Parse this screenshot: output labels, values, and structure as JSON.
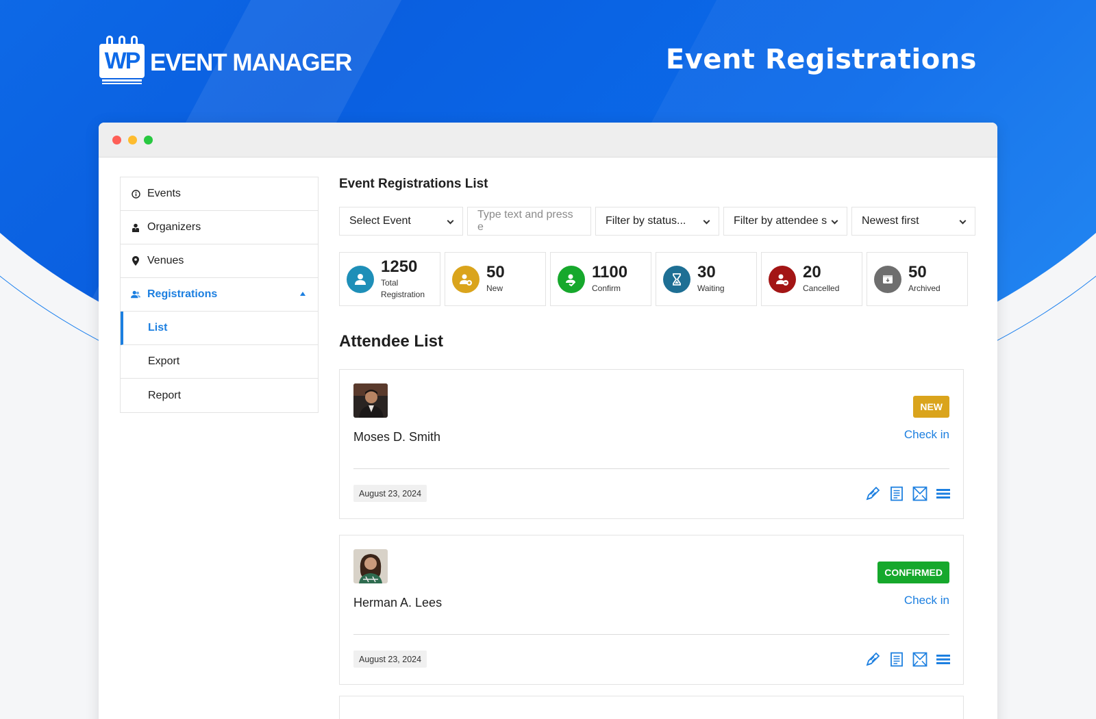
{
  "brand": {
    "logo_letters": "WP",
    "name": "EVENT MANAGER"
  },
  "page_heading": "Event Registrations",
  "colors": {
    "accent": "#1c7fe0",
    "hero": "#0a5fe0",
    "new": "#daa41c",
    "confirmed": "#16a82c"
  },
  "sidebar": {
    "items": [
      {
        "label": "Events",
        "icon": "info-icon"
      },
      {
        "label": "Organizers",
        "icon": "person-icon"
      },
      {
        "label": "Venues",
        "icon": "map-pin-icon"
      },
      {
        "label": "Registrations",
        "icon": "users-icon",
        "expanded": true
      },
      {
        "label": "List",
        "selected": true
      },
      {
        "label": "Export"
      },
      {
        "label": "Report"
      }
    ]
  },
  "main": {
    "title": "Event Registrations List",
    "filters": {
      "event": "Select Event",
      "search_placeholder": "Type text and press e",
      "status": "Filter by status...",
      "attendee": "Filter by attendee s",
      "sort": "Newest first"
    },
    "stats": [
      {
        "value": "1250",
        "label": "Total Registration",
        "color": "#1e8fb8",
        "icon": "user-icon"
      },
      {
        "value": "50",
        "label": "New",
        "color": "#daa41c",
        "icon": "user-plus-icon"
      },
      {
        "value": "1100",
        "label": "Confirm",
        "color": "#16a82c",
        "icon": "user-check-icon"
      },
      {
        "value": "30",
        "label": "Waiting",
        "color": "#1e6f94",
        "icon": "hourglass-icon"
      },
      {
        "value": "20",
        "label": "Cancelled",
        "color": "#a31515",
        "icon": "user-minus-icon"
      },
      {
        "value": "50",
        "label": "Archived",
        "color": "#6e6e6e",
        "icon": "archive-icon"
      }
    ],
    "attendee_heading": "Attendee List",
    "attendees": [
      {
        "name": "Moses D. Smith",
        "status": "NEW",
        "status_color": "#daa41c",
        "checkin": "Check in",
        "date": "August 23, 2024"
      },
      {
        "name": "Herman A. Lees",
        "status": "CONFIRMED",
        "status_color": "#16a82c",
        "checkin": "Check in",
        "date": "August 23, 2024"
      }
    ]
  }
}
